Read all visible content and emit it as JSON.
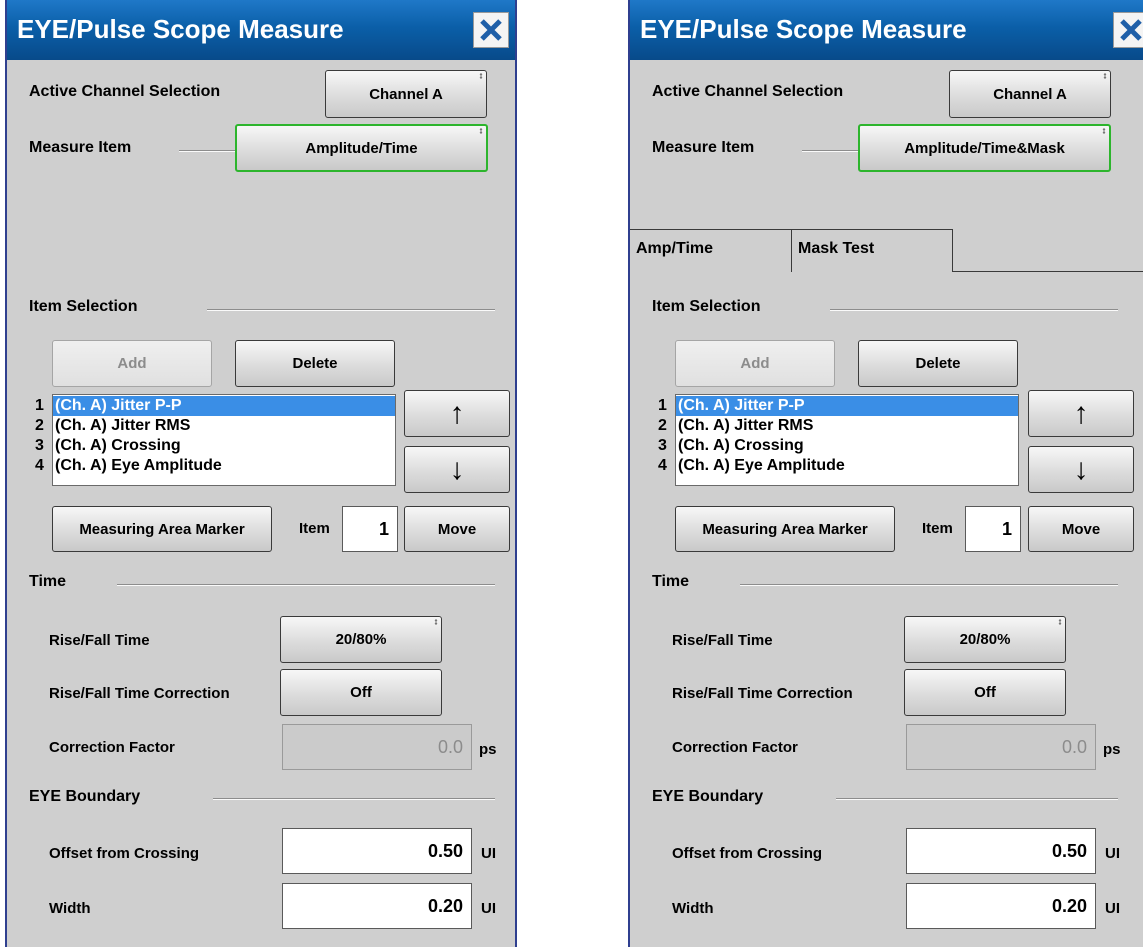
{
  "left": {
    "title": "EYE/Pulse Scope Measure",
    "active_channel_label": "Active Channel Selection",
    "channel_button": "Channel A",
    "measure_item_label": "Measure Item",
    "measure_item_button": "Amplitude/Time",
    "item_selection_label": "Item Selection",
    "add_button": "Add",
    "delete_button": "Delete",
    "items": [
      "(Ch. A) Jitter P-P",
      "(Ch. A) Jitter RMS",
      "(Ch. A) Crossing",
      "(Ch. A) Eye Amplitude"
    ],
    "item_numbers": [
      "1",
      "2",
      "3",
      "4"
    ],
    "up_arrow": "↑",
    "down_arrow": "↓",
    "measuring_area_marker_button": "Measuring Area Marker",
    "item_label": "Item",
    "item_value": "1",
    "move_button": "Move",
    "time_label": "Time",
    "rise_fall_time_label": "Rise/Fall Time",
    "rise_fall_time_value": "20/80%",
    "rise_fall_correction_label": "Rise/Fall Time Correction",
    "rise_fall_correction_value": "Off",
    "correction_factor_label": "Correction Factor",
    "correction_factor_value": "0.0",
    "correction_factor_unit": "ps",
    "eye_boundary_label": "EYE Boundary",
    "offset_label": "Offset from Crossing",
    "offset_value": "0.50",
    "offset_unit": "UI",
    "width_label": "Width",
    "width_value": "0.20",
    "width_unit": "UI"
  },
  "right": {
    "title": "EYE/Pulse Scope Measure",
    "active_channel_label": "Active Channel Selection",
    "channel_button": "Channel A",
    "measure_item_label": "Measure Item",
    "measure_item_button": "Amplitude/Time&Mask",
    "tabs": [
      "Amp/Time",
      "Mask Test"
    ],
    "item_selection_label": "Item Selection",
    "add_button": "Add",
    "delete_button": "Delete",
    "items": [
      "(Ch. A) Jitter P-P",
      "(Ch. A) Jitter RMS",
      "(Ch. A) Crossing",
      "(Ch. A) Eye Amplitude"
    ],
    "item_numbers": [
      "1",
      "2",
      "3",
      "4"
    ],
    "up_arrow": "↑",
    "down_arrow": "↓",
    "measuring_area_marker_button": "Measuring Area Marker",
    "item_label": "Item",
    "item_value": "1",
    "move_button": "Move",
    "time_label": "Time",
    "rise_fall_time_label": "Rise/Fall Time",
    "rise_fall_time_value": "20/80%",
    "rise_fall_correction_label": "Rise/Fall Time Correction",
    "rise_fall_correction_value": "Off",
    "correction_factor_label": "Correction Factor",
    "correction_factor_value": "0.0",
    "correction_factor_unit": "ps",
    "eye_boundary_label": "EYE Boundary",
    "offset_label": "Offset from Crossing",
    "offset_value": "0.50",
    "offset_unit": "UI",
    "width_label": "Width",
    "width_value": "0.20",
    "width_unit": "UI"
  },
  "colors": {
    "title_bar": "#0b5fa8",
    "panel_bg": "#cfcfcf",
    "selection": "#3a8ee6",
    "focus_border": "#2db52d"
  }
}
